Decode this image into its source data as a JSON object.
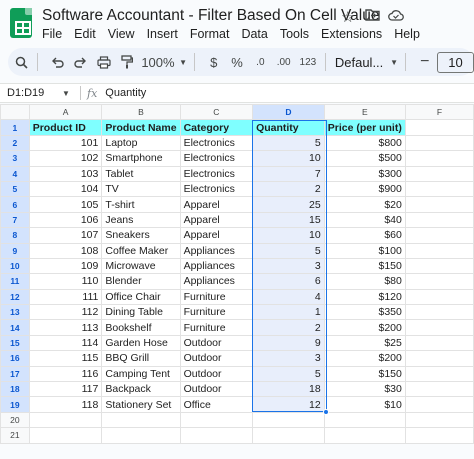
{
  "title": "Software Accountant - Filter Based On Cell Value",
  "menu": [
    "File",
    "Edit",
    "View",
    "Insert",
    "Format",
    "Data",
    "Tools",
    "Extensions",
    "Help"
  ],
  "toolbar": {
    "zoom": "100%",
    "currency": "$",
    "percent": "%",
    "decrease_decimal": ".0",
    "increase_decimal": ".00",
    "number_format": "123",
    "font": "Defaul...",
    "font_size": "10"
  },
  "formula_bar": {
    "name_box": "D1:D19",
    "fx": "fx",
    "content": "Quantity"
  },
  "columns": [
    "A",
    "B",
    "C",
    "D",
    "E",
    "F"
  ],
  "row_numbers": [
    "1",
    "2",
    "3",
    "4",
    "5",
    "6",
    "7",
    "8",
    "9",
    "10",
    "11",
    "12",
    "13",
    "14",
    "15",
    "16",
    "17",
    "18",
    "19",
    "20",
    "21"
  ],
  "headers": [
    "Product ID",
    "Product Name",
    "Category",
    "Quantity",
    "Price (per unit)"
  ],
  "rows": [
    [
      "101",
      "Laptop",
      "Electronics",
      "5",
      "$800"
    ],
    [
      "102",
      "Smartphone",
      "Electronics",
      "10",
      "$500"
    ],
    [
      "103",
      "Tablet",
      "Electronics",
      "7",
      "$300"
    ],
    [
      "104",
      "TV",
      "Electronics",
      "2",
      "$900"
    ],
    [
      "105",
      "T-shirt",
      "Apparel",
      "25",
      "$20"
    ],
    [
      "106",
      "Jeans",
      "Apparel",
      "15",
      "$40"
    ],
    [
      "107",
      "Sneakers",
      "Apparel",
      "10",
      "$60"
    ],
    [
      "108",
      "Coffee Maker",
      "Appliances",
      "5",
      "$100"
    ],
    [
      "109",
      "Microwave",
      "Appliances",
      "3",
      "$150"
    ],
    [
      "110",
      "Blender",
      "Appliances",
      "6",
      "$80"
    ],
    [
      "111",
      "Office Chair",
      "Furniture",
      "4",
      "$120"
    ],
    [
      "112",
      "Dining Table",
      "Furniture",
      "1",
      "$350"
    ],
    [
      "113",
      "Bookshelf",
      "Furniture",
      "2",
      "$200"
    ],
    [
      "114",
      "Garden Hose",
      "Outdoor",
      "9",
      "$25"
    ],
    [
      "115",
      "BBQ Grill",
      "Outdoor",
      "3",
      "$200"
    ],
    [
      "116",
      "Camping Tent",
      "Outdoor",
      "5",
      "$150"
    ],
    [
      "117",
      "Backpack",
      "Outdoor",
      "18",
      "$30"
    ],
    [
      "118",
      "Stationery Set",
      "Office",
      "12",
      "$10"
    ]
  ]
}
